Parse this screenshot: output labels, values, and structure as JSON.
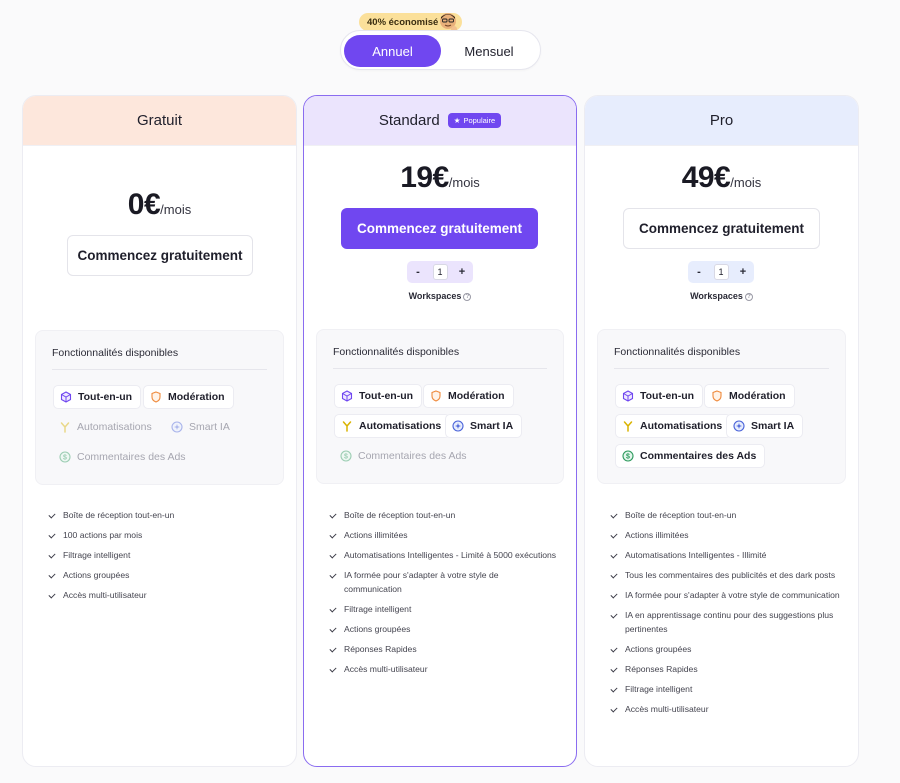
{
  "billing": {
    "save_badge": "40% économisé",
    "options": [
      "Annuel",
      "Mensuel"
    ],
    "selected": "Annuel"
  },
  "plans": [
    {
      "name": "Gratuit",
      "price": "0€",
      "unit": "/mois",
      "cta": "Commencez gratuitement",
      "features_title": "Fonctionnalités disponibles",
      "chips": [
        {
          "label": "Tout-en-un",
          "icon": "cube-icon",
          "enabled": true
        },
        {
          "label": "Modération",
          "icon": "shield-icon",
          "enabled": true
        },
        {
          "label": "Automatisations",
          "icon": "branch-icon",
          "enabled": false
        },
        {
          "label": "Smart IA",
          "icon": "sparkle-badge-icon",
          "enabled": false
        },
        {
          "label": "Commentaires des Ads",
          "icon": "dollar-icon",
          "enabled": false
        }
      ],
      "bullets": [
        "Boîte de réception tout-en-un",
        "100 actions par mois",
        "Filtrage intelligent",
        "Actions groupées",
        "Accès multi-utilisateur"
      ]
    },
    {
      "name": "Standard",
      "badge": "Populaire",
      "price": "19€",
      "unit": "/mois",
      "cta": "Commencez gratuitement",
      "workspaces_value": "1",
      "workspaces_label": "Workspaces",
      "features_title": "Fonctionnalités disponibles",
      "chips": [
        {
          "label": "Tout-en-un",
          "icon": "cube-icon",
          "enabled": true
        },
        {
          "label": "Modération",
          "icon": "shield-icon",
          "enabled": true
        },
        {
          "label": "Automatisations",
          "icon": "branch-icon",
          "enabled": true
        },
        {
          "label": "Smart IA",
          "icon": "sparkle-badge-icon",
          "enabled": true
        },
        {
          "label": "Commentaires des Ads",
          "icon": "dollar-icon",
          "enabled": false
        }
      ],
      "bullets": [
        "Boîte de réception tout-en-un",
        "Actions illimitées",
        "Automatisations Intelligentes - Limité à 5000 exécutions",
        "IA formée pour s'adapter à votre style de communication",
        "Filtrage intelligent",
        "Actions groupées",
        "Réponses Rapides",
        "Accès multi-utilisateur"
      ]
    },
    {
      "name": "Pro",
      "price": "49€",
      "unit": "/mois",
      "cta": "Commencez gratuitement",
      "workspaces_value": "1",
      "workspaces_label": "Workspaces",
      "features_title": "Fonctionnalités disponibles",
      "chips": [
        {
          "label": "Tout-en-un",
          "icon": "cube-icon",
          "enabled": true
        },
        {
          "label": "Modération",
          "icon": "shield-icon",
          "enabled": true
        },
        {
          "label": "Automatisations",
          "icon": "branch-icon",
          "enabled": true
        },
        {
          "label": "Smart IA",
          "icon": "sparkle-badge-icon",
          "enabled": true
        },
        {
          "label": "Commentaires des Ads",
          "icon": "dollar-icon",
          "enabled": true
        }
      ],
      "bullets": [
        "Boîte de réception tout-en-un",
        "Actions illimitées",
        "Automatisations Intelligentes - Illimité",
        "Tous les commentaires des publicités et des dark posts",
        "IA formée pour s'adapter à votre style de communication",
        "IA en apprentissage continu pour des suggestions plus pertinentes",
        "Actions groupées",
        "Réponses Rapides",
        "Filtrage intelligent",
        "Accès multi-utilisateur"
      ]
    }
  ],
  "colors": {
    "accent": "#7047f0",
    "free_header": "#fde7dc",
    "standard_header": "#ebe4fd",
    "pro_header": "#e7edfd"
  }
}
